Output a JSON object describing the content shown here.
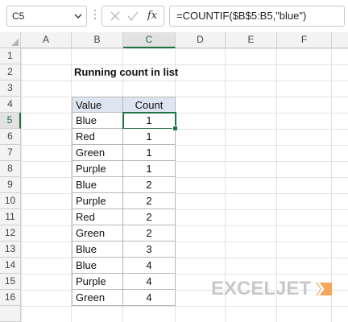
{
  "formula_bar": {
    "name_box": "C5",
    "fx_label": "fx",
    "formula": "=COUNTIF($B$5:B5,\"blue\")"
  },
  "columns": [
    "A",
    "B",
    "C",
    "D",
    "E",
    "F"
  ],
  "rows": [
    "1",
    "2",
    "3",
    "4",
    "5",
    "6",
    "7",
    "8",
    "9",
    "10",
    "11",
    "12",
    "13",
    "14",
    "15",
    "16"
  ],
  "selected_cell": {
    "column": "C",
    "row": "5"
  },
  "sheet": {
    "title": "Running count in list",
    "table": {
      "headers": [
        "Value",
        "Count"
      ],
      "rows": [
        {
          "value": "Blue",
          "count": "1"
        },
        {
          "value": "Red",
          "count": "1"
        },
        {
          "value": "Green",
          "count": "1"
        },
        {
          "value": "Purple",
          "count": "1"
        },
        {
          "value": "Blue",
          "count": "2"
        },
        {
          "value": "Purple",
          "count": "2"
        },
        {
          "value": "Red",
          "count": "2"
        },
        {
          "value": "Green",
          "count": "2"
        },
        {
          "value": "Blue",
          "count": "3"
        },
        {
          "value": "Blue",
          "count": "4"
        },
        {
          "value": "Purple",
          "count": "4"
        },
        {
          "value": "Green",
          "count": "4"
        }
      ]
    }
  },
  "logo": {
    "text": "EXCELJET"
  },
  "colors": {
    "accent": "#217346",
    "header_fill": "#dde5f1",
    "logo": "#c9c9c9",
    "logo_mark": "#f5a85d"
  }
}
